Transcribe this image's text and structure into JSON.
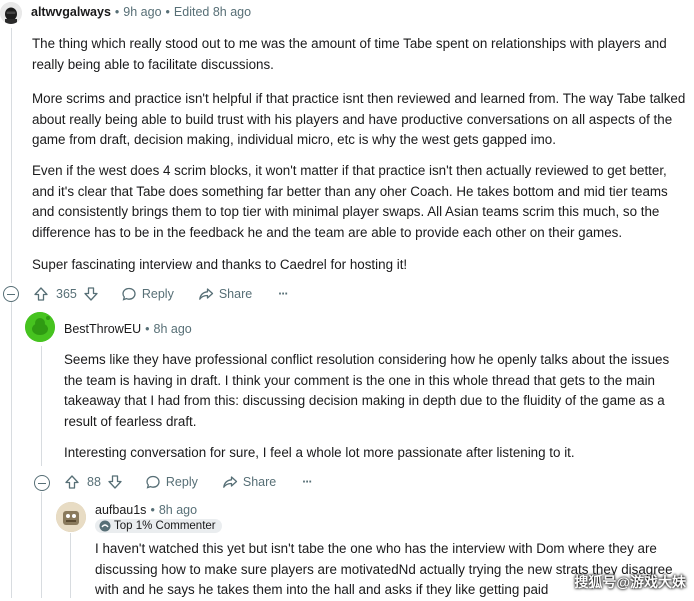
{
  "comment1": {
    "username": "altwvgalways",
    "time": "9h ago",
    "edited": "Edited 8h ago",
    "paragraphs": [
      "The thing which really stood out to me was the amount of time Tabe spent on relationships with players and really being able to facilitate discussions.",
      "More scrims and practice isn't helpful if that practice isnt then reviewed and learned from. The way Tabe talked about really being able to build trust with his players and have productive conversations on all aspects of the game from draft, decision making, individual micro, etc is why the west gets gapped imo.",
      "Even if the west does 4 scrim blocks, it won't matter if that practice isn't then actually reviewed to get better, and it's clear that Tabe does something far better than any oher Coach. He takes bottom and mid tier teams and consistently brings them to top tier with minimal player swaps. All Asian teams scrim this much, so the difference has to be in the feedback he and the team are able to provide each other on their games.",
      "Super fascinating interview and thanks to Caedrel for hosting it!"
    ],
    "votes": "365",
    "reply_label": "Reply",
    "share_label": "Share",
    "more_label": "···"
  },
  "comment2": {
    "username": "BestThrowEU",
    "time": "8h ago",
    "paragraphs": [
      "Seems like they have professional conflict resolution considering how he openly talks about the issues the team is having in draft. I think your comment is the one in this whole thread that gets to the main takeaway that I had from this: discussing decision making in depth due to the fluidity of the game as a result of fearless draft.",
      "Interesting conversation for sure, I feel a whole lot more passionate after listening to it."
    ],
    "votes": "88",
    "reply_label": "Reply",
    "share_label": "Share",
    "more_label": "···"
  },
  "comment3": {
    "username": "aufbau1s",
    "time": "8h ago",
    "flair": "Top 1% Commenter",
    "text": "I haven't watched this yet but isn't tabe the one who has the interview with Dom where they are discussing how to make sure players are motivatedNd actually trying the new strats they disagree with and he says he takes them into the hall and asks if they like getting paid"
  },
  "watermark": "搜狐号@游戏大妹",
  "colors": {
    "text": "#1a1a1b",
    "meta": "#576f76",
    "thread": "#d8dce0",
    "badge_bg": "#eaedef"
  }
}
